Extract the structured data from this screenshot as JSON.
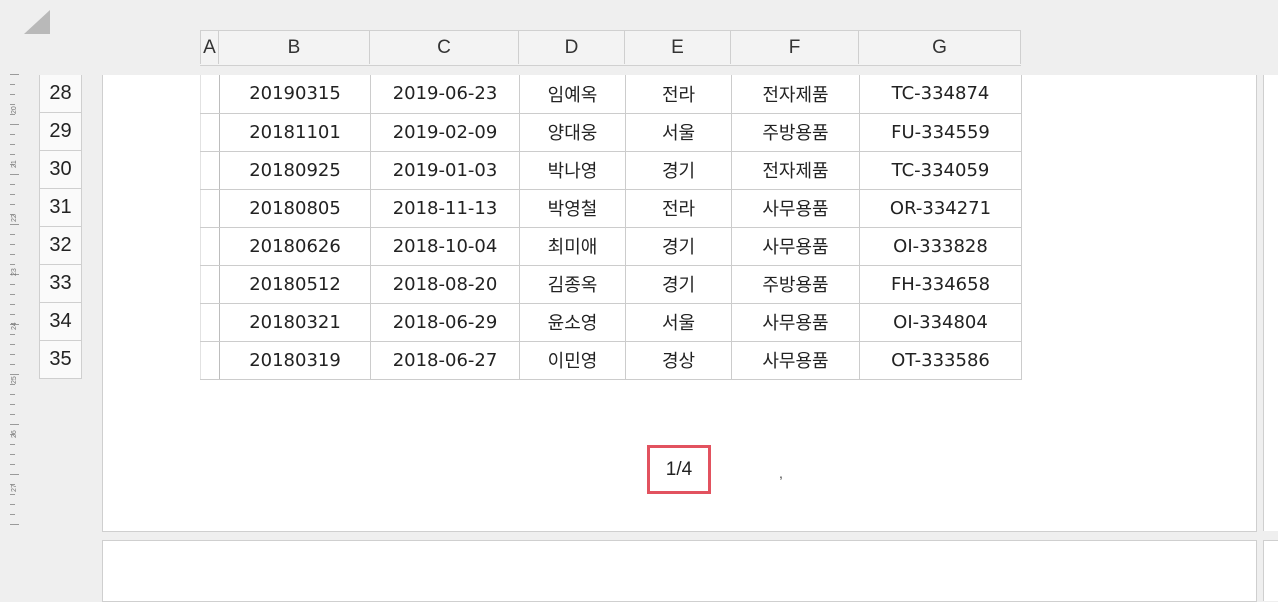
{
  "columns": [
    "A",
    "B",
    "C",
    "D",
    "E",
    "F",
    "G"
  ],
  "row_numbers": [
    "28",
    "29",
    "30",
    "31",
    "32",
    "33",
    "34",
    "35"
  ],
  "ruler_labels": [
    "20",
    "21",
    "22",
    "23",
    "24",
    "25",
    "26",
    "27"
  ],
  "rows": [
    [
      "20190315",
      "2019-06-23",
      "임예옥",
      "전라",
      "전자제품",
      "TC-334874"
    ],
    [
      "20181101",
      "2019-02-09",
      "양대웅",
      "서울",
      "주방용품",
      "FU-334559"
    ],
    [
      "20180925",
      "2019-01-03",
      "박나영",
      "경기",
      "전자제품",
      "TC-334059"
    ],
    [
      "20180805",
      "2018-11-13",
      "박영철",
      "전라",
      "사무용품",
      "OR-334271"
    ],
    [
      "20180626",
      "2018-10-04",
      "최미애",
      "경기",
      "사무용품",
      "OI-333828"
    ],
    [
      "20180512",
      "2018-08-20",
      "김종옥",
      "경기",
      "주방용품",
      "FH-334658"
    ],
    [
      "20180321",
      "2018-06-29",
      "윤소영",
      "서울",
      "사무용품",
      "OI-334804"
    ],
    [
      "20180319",
      "2018-06-27",
      "이민영",
      "경상",
      "사무용품",
      "OT-333586"
    ]
  ],
  "footer": {
    "page_number": "1/4",
    "mark": ","
  },
  "colors": {
    "highlight": "#e2525f"
  }
}
